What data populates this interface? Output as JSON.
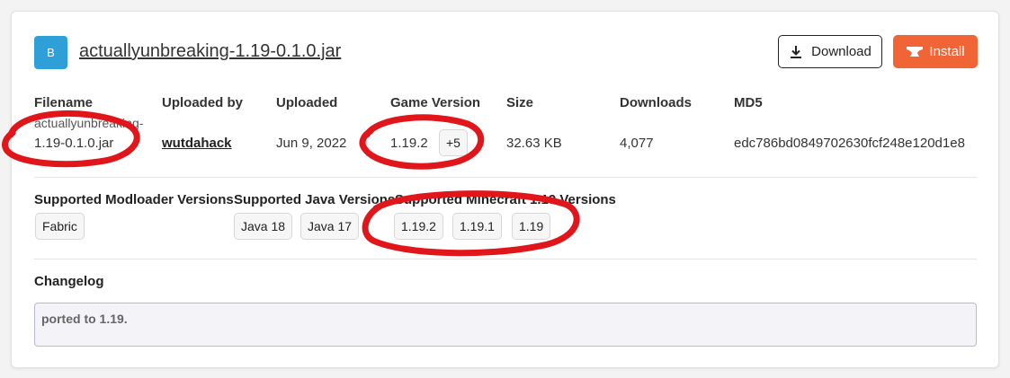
{
  "file": {
    "avatar_letter": "B",
    "title": "actuallyunbreaking-1.19-0.1.0.jar"
  },
  "actions": {
    "download_label": "Download",
    "install_label": "Install"
  },
  "columns": {
    "filename": "Filename",
    "uploaded_by": "Uploaded by",
    "uploaded": "Uploaded",
    "game_version": "Game Version",
    "size": "Size",
    "downloads": "Downloads",
    "md5": "MD5"
  },
  "values": {
    "filename_line1": "actuallyunbreaking-",
    "filename_line2": "1.19-0.1.0.jar",
    "uploader": "wutdahack",
    "uploaded": "Jun 9, 2022",
    "game_version": "1.19.2",
    "game_version_more": "+5",
    "size": "32.63 KB",
    "downloads": "4,077",
    "md5": "edc786bd0849702630fcf248e120d1e8"
  },
  "sections": {
    "modloader_heading": "Supported Modloader Versions",
    "java_heading": "Supported Java Versions",
    "minecraft_heading": "Supported Minecraft 1.19 Versions",
    "modloaders": [
      "Fabric"
    ],
    "java": [
      "Java 18",
      "Java 17"
    ],
    "minecraft": [
      "1.19.2",
      "1.19.1",
      "1.19"
    ]
  },
  "changelog": {
    "heading": "Changelog",
    "text": "ported to 1.19."
  },
  "colors": {
    "avatar": "#2f9fd8",
    "install": "#f16436",
    "annotation": "#e0161b"
  },
  "icons": {
    "download": "download-icon",
    "install": "anvil-icon"
  }
}
